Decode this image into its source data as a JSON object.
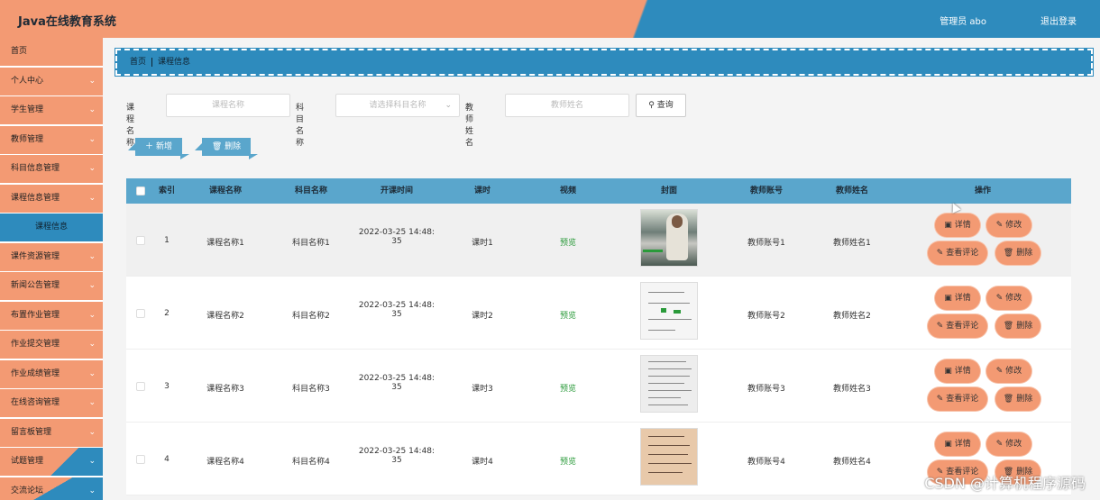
{
  "header": {
    "title": "Java在线教育系统",
    "user": "管理员 abo",
    "logout": "退出登录"
  },
  "sidebar": {
    "items": [
      {
        "label": "首页",
        "chevron": false
      },
      {
        "label": "个人中心",
        "chevron": true
      },
      {
        "label": "学生管理",
        "chevron": true
      },
      {
        "label": "教师管理",
        "chevron": true
      },
      {
        "label": "科目信息管理",
        "chevron": true
      },
      {
        "label": "课程信息管理",
        "chevron": true
      },
      {
        "label": "课程信息",
        "chevron": false,
        "sub": true
      },
      {
        "label": "课件资源管理",
        "chevron": true
      },
      {
        "label": "新闻公告管理",
        "chevron": true
      },
      {
        "label": "布置作业管理",
        "chevron": true
      },
      {
        "label": "作业提交管理",
        "chevron": true
      },
      {
        "label": "作业成绩管理",
        "chevron": true
      },
      {
        "label": "在线咨询管理",
        "chevron": true
      },
      {
        "label": "留言板管理",
        "chevron": true
      },
      {
        "label": "试题管理",
        "chevron": true
      },
      {
        "label": "交流论坛",
        "chevron": true
      }
    ]
  },
  "breadcrumb": {
    "home": "首页",
    "current": "课程信息"
  },
  "search": {
    "course_label": "课程名称",
    "course_placeholder": "课程名称",
    "subject_label": "科目名称",
    "subject_placeholder": "请选择科目名称",
    "teacher_label": "教师姓名",
    "teacher_placeholder": "教师姓名",
    "query_button": "查询"
  },
  "actions": {
    "add": "新增",
    "delete": "删除"
  },
  "table": {
    "headers": [
      "索引",
      "课程名称",
      "科目名称",
      "开课时间",
      "课时",
      "视频",
      "封面",
      "教师账号",
      "教师姓名",
      "操作"
    ],
    "rows": [
      {
        "index": "1",
        "course": "课程名称1",
        "subject": "科目名称1",
        "time1": "2022-03-25 14:48:",
        "time2": "35",
        "hours": "课时1",
        "video": "预览",
        "account": "教师账号1",
        "teacher": "教师姓名1"
      },
      {
        "index": "2",
        "course": "课程名称2",
        "subject": "科目名称2",
        "time1": "2022-03-25 14:48:",
        "time2": "35",
        "hours": "课时2",
        "video": "预览",
        "account": "教师账号2",
        "teacher": "教师姓名2"
      },
      {
        "index": "3",
        "course": "课程名称3",
        "subject": "科目名称3",
        "time1": "2022-03-25 14:48:",
        "time2": "35",
        "hours": "课时3",
        "video": "预览",
        "account": "教师账号3",
        "teacher": "教师姓名3"
      },
      {
        "index": "4",
        "course": "课程名称4",
        "subject": "科目名称4",
        "time1": "2022-03-25 14:48:",
        "time2": "35",
        "hours": "课时4",
        "video": "预览",
        "account": "教师账号4",
        "teacher": "教师姓名4"
      }
    ],
    "ops": {
      "detail": "详情",
      "edit": "修改",
      "comments": "查看评论",
      "delete": "删除"
    }
  },
  "watermark": "CSDN @计算机程序源码",
  "icons": {
    "search": "search-icon",
    "add": "plus-icon",
    "delete": "trash-icon",
    "detail": "document-icon",
    "edit": "pencil-icon",
    "chevron": "chevron-down-icon"
  },
  "colors": {
    "accent_orange": "#f39a73",
    "accent_blue": "#2e8bbd",
    "table_header": "#5aa6cc",
    "link_green": "#2a9a3a"
  }
}
